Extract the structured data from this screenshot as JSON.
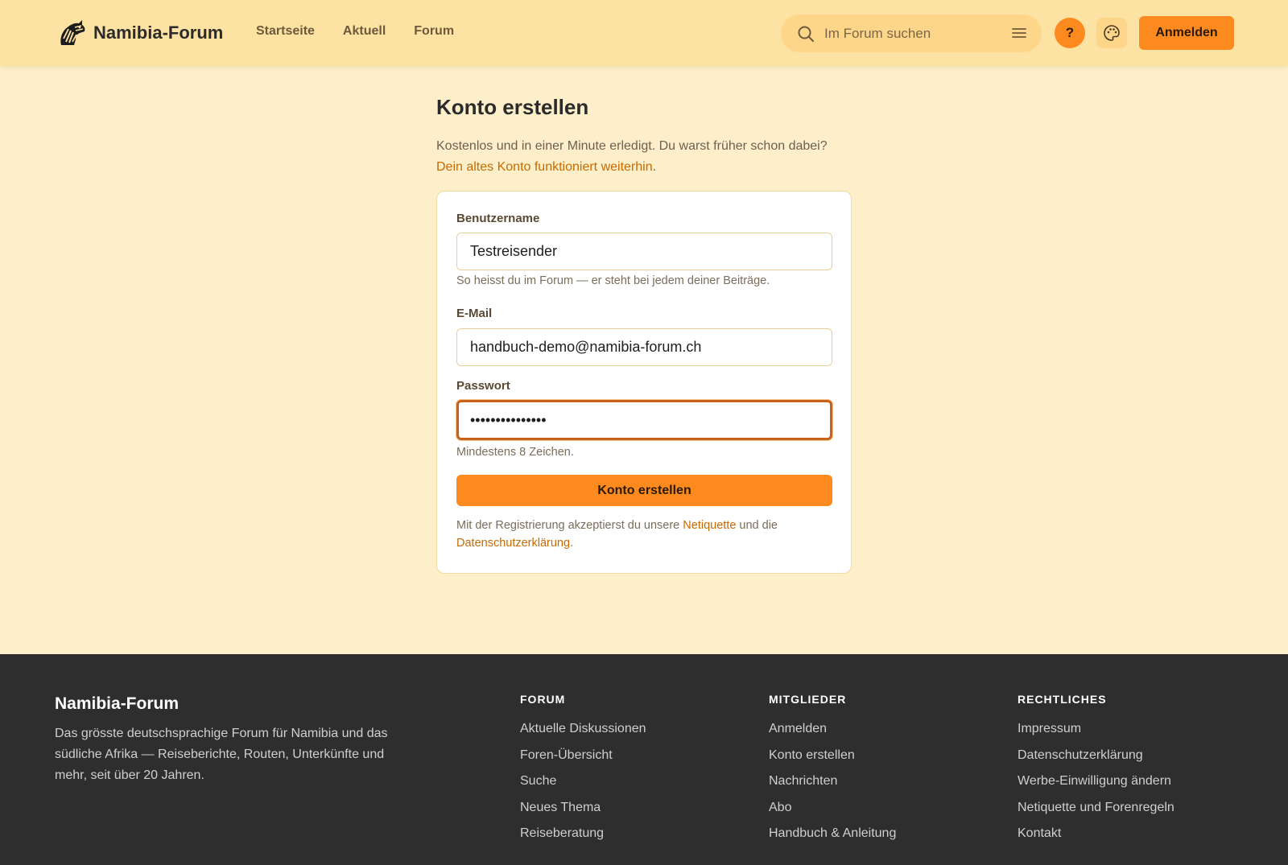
{
  "header": {
    "brand": "Namibia-Forum",
    "nav": [
      "Startseite",
      "Aktuell",
      "Forum"
    ],
    "search_placeholder": "Im Forum suchen",
    "help_label": "?",
    "login_label": "Anmelden"
  },
  "main": {
    "title": "Konto erstellen",
    "intro_text": "Kostenlos und in einer Minute erledigt. Du warst früher schon dabei?",
    "intro_link": "Dein altes Konto funktioniert weiterhin",
    "intro_after_link": "."
  },
  "form": {
    "username_label": "Benutzername",
    "username_value": "Testreisender",
    "username_hint": "So heisst du im Forum — er steht bei jedem deiner Beiträge.",
    "email_label": "E-Mail",
    "email_value": "handbuch-demo@namibia-forum.ch",
    "password_label": "Passwort",
    "password_value": "•••••••••••••••",
    "password_hint": "Mindestens 8 Zeichen.",
    "submit_label": "Konto erstellen",
    "legal_before": "Mit der Registrierung akzeptierst du unsere ",
    "legal_link1": "Netiquette",
    "legal_middle": " und die ",
    "legal_link2": "Datenschutzerklärung",
    "legal_after": "."
  },
  "footer": {
    "brand": "Namibia-Forum",
    "description": "Das grösste deutschsprachige Forum für Namibia und das südliche Afrika — Reiseberichte, Routen, Unterkünfte und mehr, seit über 20 Jahren.",
    "columns": [
      {
        "title": "FORUM",
        "links": [
          "Aktuelle Diskussionen",
          "Foren-Übersicht",
          "Suche",
          "Neues Thema",
          "Reiseberatung"
        ]
      },
      {
        "title": "MITGLIEDER",
        "links": [
          "Anmelden",
          "Konto erstellen",
          "Nachrichten",
          "Abo",
          "Handbuch & Anleitung"
        ]
      },
      {
        "title": "RECHTLICHES",
        "links": [
          "Impressum",
          "Datenschutzerklärung",
          "Werbe-Einwilligung ändern",
          "Netiquette und Forenregeln",
          "Kontakt"
        ]
      }
    ]
  },
  "icons": {
    "logo": "zebra-logo-icon",
    "search": "search-icon",
    "filter": "menu-lines-icon",
    "theme": "palette-icon"
  },
  "colors": {
    "accent": "#fd8a1e",
    "header_bg": "#fde3a3",
    "page_bg": "#fdefc9",
    "link": "#c86a00",
    "footer_bg": "#2e2e2e"
  }
}
